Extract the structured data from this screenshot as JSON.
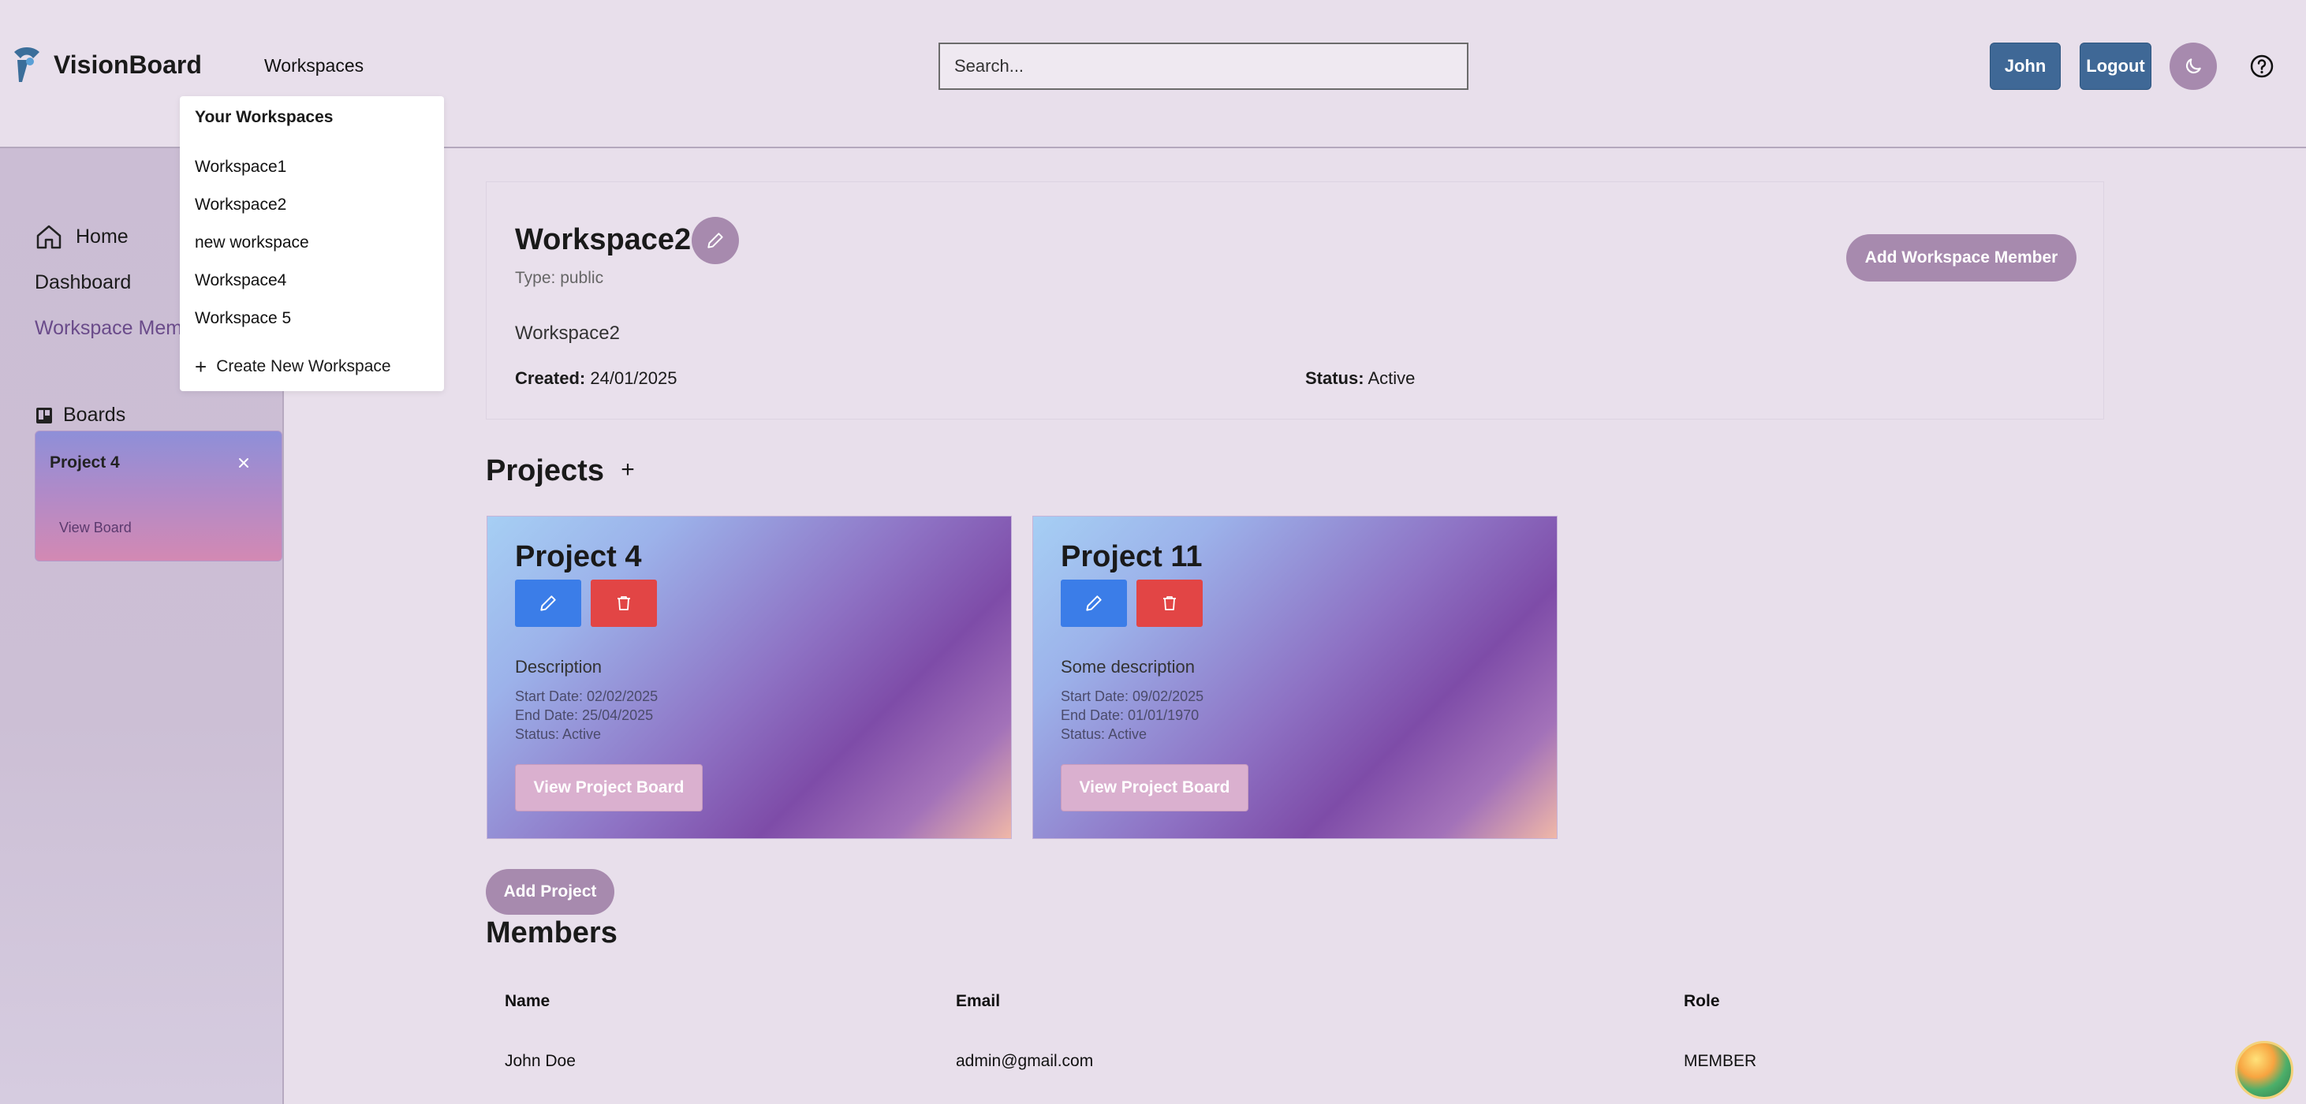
{
  "header": {
    "app_name": "VisionBoard",
    "nav_workspaces": "Workspaces",
    "search_placeholder": "Search...",
    "user_button": "John",
    "logout_button": "Logout"
  },
  "dropdown": {
    "title": "Your Workspaces",
    "items": [
      "Workspace1",
      "Workspace2",
      "new workspace",
      "Workspace4",
      "Workspace 5"
    ],
    "create_label": "Create New Workspace"
  },
  "sidebar": {
    "home": "Home",
    "dashboard": "Dashboard",
    "workspace_members": "Workspace Members",
    "boards_label": "Boards",
    "board_card": {
      "title": "Project 4",
      "view_label": "View Board"
    }
  },
  "workspace": {
    "name": "Workspace2",
    "type_text": "Type: public",
    "description": "Workspace2",
    "created_label": "Created:",
    "created_value": "24/01/2025",
    "status_label": "Status:",
    "status_value": "Active",
    "add_member_button": "Add Workspace Member"
  },
  "projects": {
    "title": "Projects",
    "add_icon": "+",
    "cards": [
      {
        "title": "Project 4",
        "description": "Description",
        "start": "Start Date: 02/02/2025",
        "end": "End Date: 25/04/2025",
        "status": "Status: Active",
        "view_button": "View Project Board"
      },
      {
        "title": "Project 11",
        "description": "Some description",
        "start": "Start Date: 09/02/2025",
        "end": "End Date: 01/01/1970",
        "status": "Status: Active",
        "view_button": "View Project Board"
      }
    ],
    "add_project_button": "Add Project"
  },
  "members": {
    "title": "Members",
    "columns": [
      "Name",
      "Email",
      "Role"
    ],
    "rows": [
      [
        "John Doe",
        "admin@gmail.com",
        "MEMBER"
      ]
    ]
  },
  "colors": {
    "accent_purple": "#a78aae",
    "nav_button_blue": "#3f6896",
    "edit_blue": "#3b7de8",
    "delete_red": "#e24545"
  },
  "icons": [
    "logo-icon",
    "moon-icon",
    "help-icon",
    "home-icon",
    "board-icon",
    "close-icon",
    "pencil-icon",
    "trash-icon",
    "plus-icon"
  ]
}
